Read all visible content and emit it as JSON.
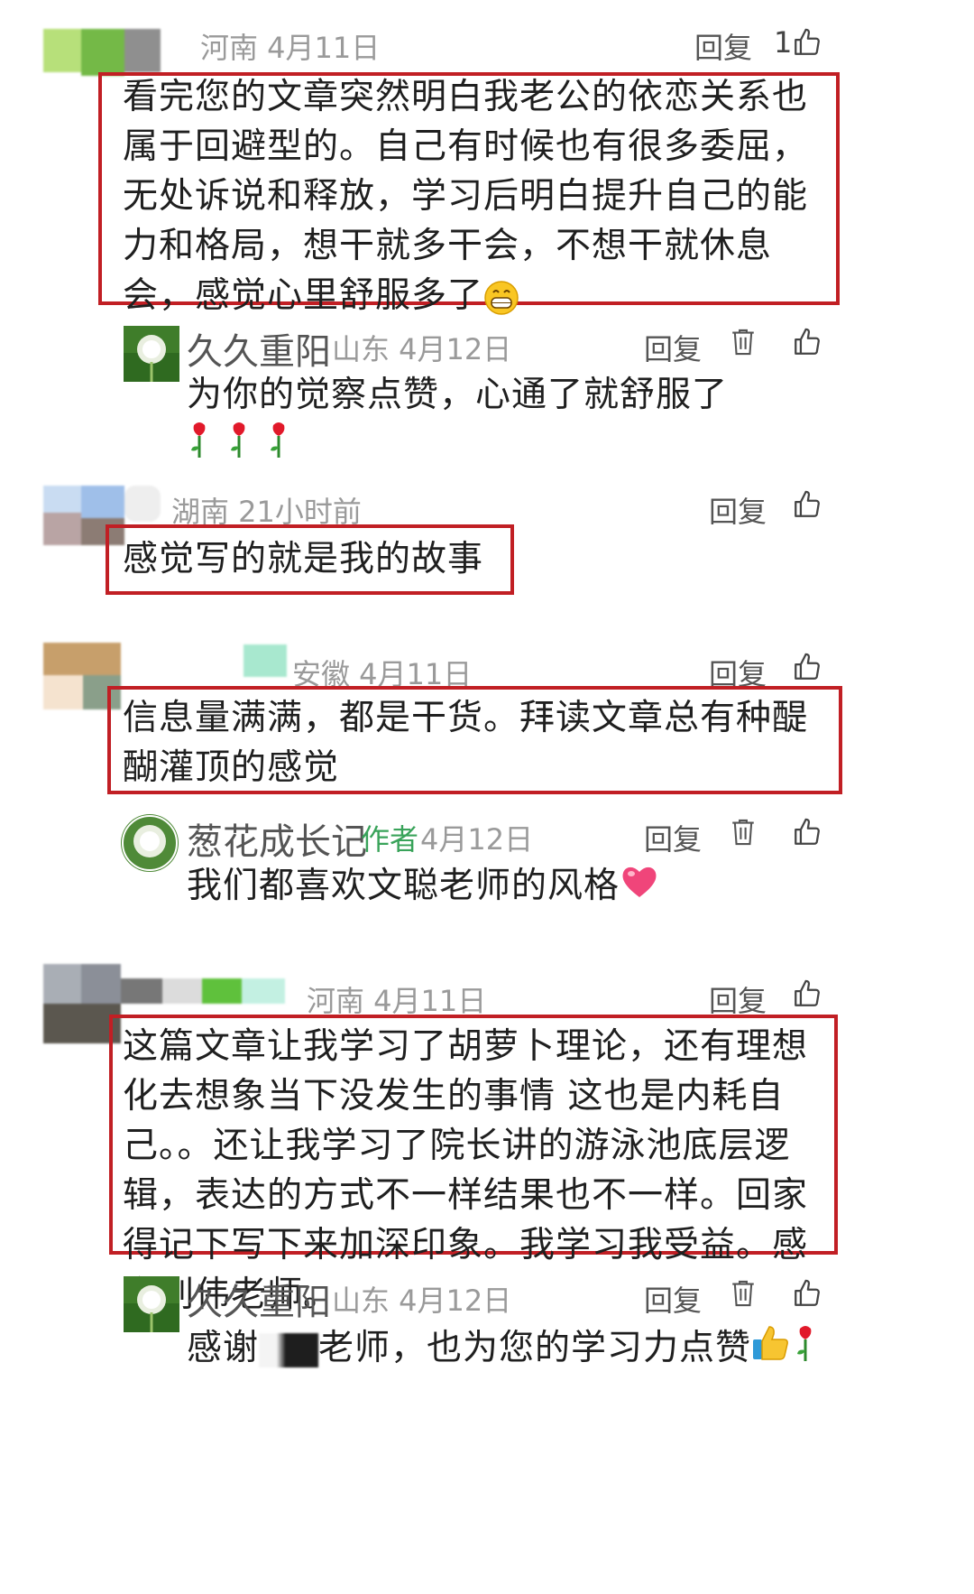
{
  "ui": {
    "reply_label": "回复"
  },
  "comments": [
    {
      "meta": "河南 4月11日",
      "likes": "1",
      "text": "看完您的文章突然明白我老公的依恋关系也属于回避型的。自己有时候也有很多委屈，无处诉说和释放，学习后明白提升自己的能力和格局，想干就多干会，不想干就休息会，感觉心里舒服多了",
      "emoji": "grin-emoji",
      "reply": {
        "name": "久久重阳",
        "meta": "山东 4月12日",
        "text": "为你的觉察点赞，心通了就舒服了",
        "emoji": "rose-emoji"
      }
    },
    {
      "meta": "湖南 21小时前",
      "text": "感觉写的就是我的故事"
    },
    {
      "meta": "安徽 4月11日",
      "text": "信息量满满，都是干货。拜读文章总有种醍醐灌顶的感觉",
      "reply": {
        "name": "葱花成长记",
        "author_tag": "作者",
        "meta": "4月12日",
        "text": "我们都喜欢文聪老师的风格",
        "emoji": "heart-emoji"
      }
    },
    {
      "meta": "河南 4月11日",
      "text": "这篇文章让我学习了胡萝卜理论，还有理想化去想象当下没发生的事情 这也是内耗自己。。还让我学习了院长讲的游泳池底层逻辑，表达的方式不一样结果也不一样。回家得记下写下来加深印象。我学习我受益。感谢刘伟老师。",
      "reply": {
        "name": "久久重阳",
        "meta": "山东 4月12日",
        "text_part1": "感谢",
        "text_part2": "老师，也为您的学习力点赞",
        "emoji": "thumbs-up-emoji"
      }
    }
  ],
  "colors": {
    "highlight_box": "#c11f24",
    "author_tag": "#39a35a",
    "meta_text": "#9a9a9a"
  }
}
